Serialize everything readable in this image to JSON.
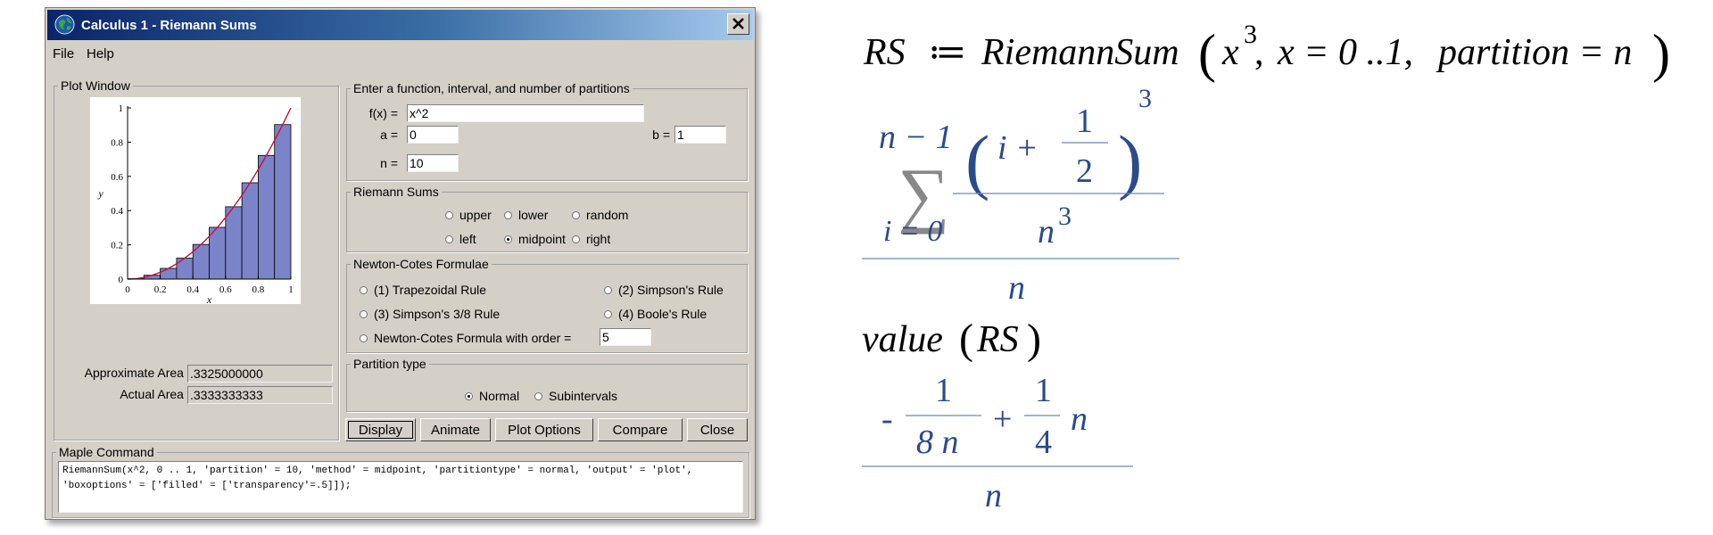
{
  "window": {
    "title": "Calculus 1 - Riemann Sums",
    "close_glyph": "✕"
  },
  "menu": [
    "File",
    "Help"
  ],
  "plot_window": {
    "legend": "Plot Window",
    "approx_label": "Approximate Area =",
    "approx_value": ".3325000000",
    "actual_label": "Actual Area =",
    "actual_value": ".3333333333"
  },
  "input": {
    "legend": "Enter a function, interval, and number of partitions",
    "fx_label": "f(x) =",
    "fx_value": "x^2",
    "a_label": "a =",
    "a_value": "0",
    "b_label": "b =",
    "b_value": "1",
    "n_label": "n =",
    "n_value": "10"
  },
  "riemann": {
    "legend": "Riemann Sums",
    "options": [
      {
        "label": "upper",
        "selected": false
      },
      {
        "label": "lower",
        "selected": false
      },
      {
        "label": "random",
        "selected": false
      },
      {
        "label": "left",
        "selected": false
      },
      {
        "label": "midpoint",
        "selected": true
      },
      {
        "label": "right",
        "selected": false
      }
    ]
  },
  "newton": {
    "legend": "Newton-Cotes Formulae",
    "options": [
      {
        "label": "(1) Trapezoidal Rule",
        "selected": false
      },
      {
        "label": "(2) Simpson's Rule",
        "selected": false
      },
      {
        "label": "(3) Simpson's 3/8 Rule",
        "selected": false
      },
      {
        "label": "(4) Boole's Rule",
        "selected": false
      },
      {
        "label": "Newton-Cotes Formula with order =",
        "selected": false
      }
    ],
    "order_value": "5"
  },
  "partition": {
    "legend": "Partition type",
    "options": [
      {
        "label": "Normal",
        "selected": true
      },
      {
        "label": "Subintervals",
        "selected": false
      }
    ]
  },
  "buttons": [
    "Display",
    "Animate",
    "Plot Options",
    "Compare",
    "Close"
  ],
  "maple_command": {
    "legend": "Maple Command",
    "text": "RiemannSum(x^2, 0 .. 1, 'partition' = 10, 'method' = midpoint, 'partitiontype' = normal, 'output' = 'plot', 'boxoptions' = ['filled' = ['transparency'=.5]]);"
  },
  "chart_data": {
    "type": "bar",
    "function": "x^2",
    "x": [
      0.05,
      0.15,
      0.25,
      0.35,
      0.45,
      0.55,
      0.65,
      0.75,
      0.85,
      0.95
    ],
    "values": [
      0.0025,
      0.0225,
      0.0625,
      0.1225,
      0.2025,
      0.3025,
      0.4225,
      0.5625,
      0.7225,
      0.9025
    ],
    "bar_width": 0.1,
    "xlim": [
      0,
      1
    ],
    "ylim": [
      0,
      1
    ],
    "xticks": [
      "0",
      "0.2",
      "0.4",
      "0.6",
      "0.8",
      "1"
    ],
    "yticks": [
      "0",
      "0.2",
      "0.4",
      "0.6",
      "0.8",
      "1"
    ],
    "xlabel": "x",
    "ylabel": "y",
    "bar_color": "#7b83c9",
    "curve_color": "#c0143c"
  },
  "worksheet": {
    "line1": {
      "lhs": "RS",
      "assign": "≔",
      "fn": "RiemannSum",
      "base": "x",
      "exp": "3",
      "arg2": "x = 0 ..1,",
      "arg3": "partition = n"
    },
    "sum": {
      "upper": "n − 1",
      "sigma": "∑",
      "lower": "i = 0",
      "var": "i +",
      "half_num": "1",
      "half_den": "2",
      "pow": "3",
      "den_base": "n",
      "den_exp": "3",
      "outer_den": "n"
    },
    "line3": {
      "fn": "value",
      "arg": "RS"
    },
    "result": {
      "minus": "-",
      "a_num": "1",
      "a_den": "8 n",
      "plus": "+",
      "b_num": "1",
      "b_den": "4",
      "b_var": "n",
      "outer_den": "n"
    },
    "input_color": "#000000",
    "output_color": "#2b4a8c"
  }
}
